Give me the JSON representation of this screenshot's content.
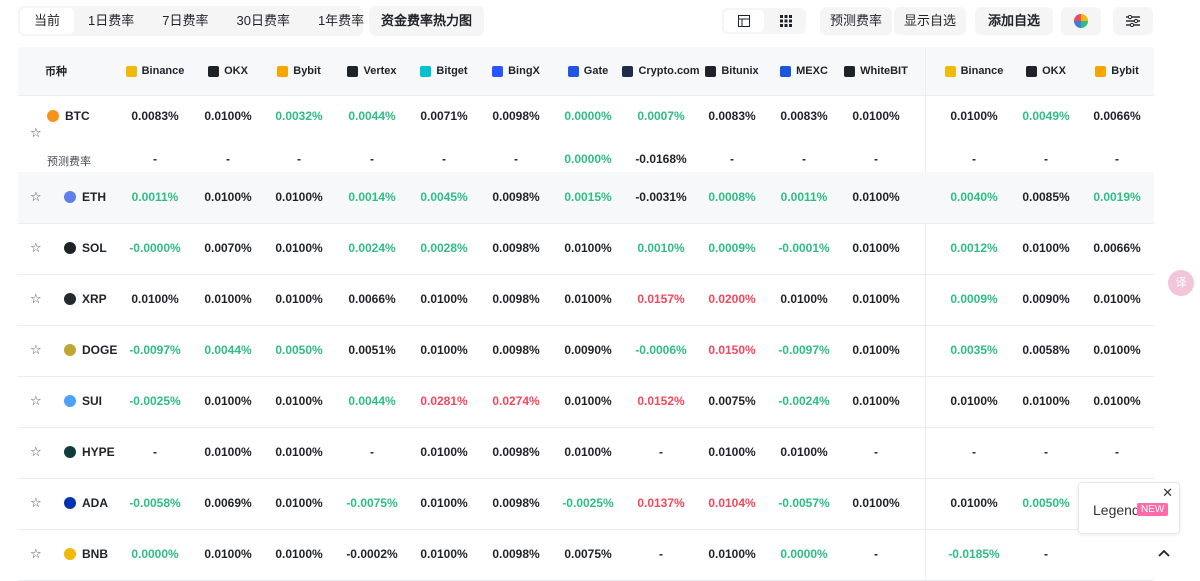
{
  "toolbar": {
    "tabs": [
      "当前",
      "1日费率",
      "7日费率",
      "30日费率",
      "1年费率"
    ],
    "heatmap_label": "资金费率热力图",
    "predict_label": "预测费率",
    "show_fav_label": "显示自选",
    "add_fav_label": "添加自选"
  },
  "table": {
    "coin_header": "币种",
    "exchanges": [
      "Binance",
      "OKX",
      "Bybit",
      "Vertex",
      "Bitget",
      "BingX",
      "Gate",
      "Crypto.com",
      "Bitunix",
      "MEXC",
      "WhiteBIT",
      "Binance",
      "OKX",
      "Bybit"
    ],
    "exchange_colors": [
      "#f0b90b",
      "#1e2329",
      "#f7a600",
      "#1e2329",
      "#00c2d1",
      "#2a54ff",
      "#2354e6",
      "#1f2b4d",
      "#1e2329",
      "#1a56db",
      "#1e2329",
      "#f0b90b",
      "#1e2329",
      "#f7a600"
    ],
    "prediction_label": "预测费率",
    "rows": [
      {
        "coin": "BTC",
        "icon_color": "#f7931a",
        "values": [
          "0.0083%",
          "0.0100%",
          "0.0032%",
          "0.0044%",
          "0.0071%",
          "0.0098%",
          "0.0000%",
          "0.0007%",
          "0.0083%",
          "0.0083%",
          "0.0100%",
          "0.0100%",
          "0.0049%",
          "0.0066%"
        ],
        "colors": [
          "k",
          "k",
          "g",
          "g",
          "k",
          "k",
          "g",
          "g",
          "k",
          "k",
          "k",
          "k",
          "g",
          "k"
        ],
        "pred": [
          "-",
          "-",
          "-",
          "-",
          "-",
          "-",
          "0.0000%",
          "-0.0168%",
          "-",
          "-",
          "-",
          "-",
          "-",
          "-"
        ],
        "pred_colors": [
          "k",
          "k",
          "k",
          "k",
          "k",
          "k",
          "g",
          "k",
          "k",
          "k",
          "k",
          "k",
          "k",
          "k"
        ]
      },
      {
        "coin": "ETH",
        "icon_color": "#627eea",
        "values": [
          "0.0011%",
          "0.0100%",
          "0.0100%",
          "0.0014%",
          "0.0045%",
          "0.0098%",
          "0.0015%",
          "-0.0031%",
          "0.0008%",
          "0.0011%",
          "0.0100%",
          "0.0040%",
          "0.0085%",
          "0.0019%"
        ],
        "colors": [
          "g",
          "k",
          "k",
          "g",
          "g",
          "k",
          "g",
          "k",
          "g",
          "g",
          "k",
          "g",
          "k",
          "g"
        ]
      },
      {
        "coin": "SOL",
        "icon_color": "#1e2329",
        "values": [
          "-0.0000%",
          "0.0070%",
          "0.0100%",
          "0.0024%",
          "0.0028%",
          "0.0098%",
          "0.0100%",
          "0.0010%",
          "0.0009%",
          "-0.0001%",
          "0.0100%",
          "0.0012%",
          "0.0100%",
          "0.0066%"
        ],
        "colors": [
          "g",
          "k",
          "k",
          "g",
          "g",
          "k",
          "k",
          "g",
          "g",
          "g",
          "k",
          "g",
          "k",
          "k"
        ]
      },
      {
        "coin": "XRP",
        "icon_color": "#23292f",
        "values": [
          "0.0100%",
          "0.0100%",
          "0.0100%",
          "0.0066%",
          "0.0100%",
          "0.0098%",
          "0.0100%",
          "0.0157%",
          "0.0200%",
          "0.0100%",
          "0.0100%",
          "0.0009%",
          "0.0090%",
          "0.0100%"
        ],
        "colors": [
          "k",
          "k",
          "k",
          "k",
          "k",
          "k",
          "k",
          "r",
          "r",
          "k",
          "k",
          "g",
          "k",
          "k"
        ]
      },
      {
        "coin": "DOGE",
        "icon_color": "#c2a633",
        "values": [
          "-0.0097%",
          "0.0044%",
          "0.0050%",
          "0.0051%",
          "0.0100%",
          "0.0098%",
          "0.0090%",
          "-0.0006%",
          "0.0150%",
          "-0.0097%",
          "0.0100%",
          "0.0035%",
          "0.0058%",
          "0.0100%"
        ],
        "colors": [
          "g",
          "g",
          "g",
          "k",
          "k",
          "k",
          "k",
          "g",
          "r",
          "g",
          "k",
          "g",
          "k",
          "k"
        ]
      },
      {
        "coin": "SUI",
        "icon_color": "#4da2ff",
        "values": [
          "-0.0025%",
          "0.0100%",
          "0.0100%",
          "0.0044%",
          "0.0281%",
          "0.0274%",
          "0.0100%",
          "0.0152%",
          "0.0075%",
          "-0.0024%",
          "0.0100%",
          "0.0100%",
          "0.0100%",
          "0.0100%"
        ],
        "colors": [
          "g",
          "k",
          "k",
          "g",
          "r",
          "r",
          "k",
          "r",
          "k",
          "g",
          "k",
          "k",
          "k",
          "k"
        ]
      },
      {
        "coin": "HYPE",
        "icon_color": "#0f3d3e",
        "values": [
          "-",
          "0.0100%",
          "0.0100%",
          "-",
          "0.0100%",
          "0.0098%",
          "0.0100%",
          "-",
          "0.0100%",
          "0.0100%",
          "-",
          "-",
          "-",
          "-"
        ],
        "colors": [
          "k",
          "k",
          "k",
          "k",
          "k",
          "k",
          "k",
          "k",
          "k",
          "k",
          "k",
          "k",
          "k",
          "k"
        ]
      },
      {
        "coin": "ADA",
        "icon_color": "#0033ad",
        "values": [
          "-0.0058%",
          "0.0069%",
          "0.0100%",
          "-0.0075%",
          "0.0100%",
          "0.0098%",
          "-0.0025%",
          "0.0137%",
          "0.0104%",
          "-0.0057%",
          "0.0100%",
          "0.0100%",
          "0.0050%",
          ""
        ],
        "colors": [
          "g",
          "k",
          "k",
          "g",
          "k",
          "k",
          "g",
          "r",
          "r",
          "g",
          "k",
          "k",
          "g",
          "k"
        ]
      },
      {
        "coin": "BNB",
        "icon_color": "#f0b90b",
        "values": [
          "0.0000%",
          "0.0100%",
          "0.0100%",
          "-0.0002%",
          "0.0100%",
          "0.0098%",
          "0.0075%",
          "-",
          "0.0100%",
          "0.0000%",
          "-",
          "-0.0185%",
          "-",
          ""
        ],
        "colors": [
          "g",
          "k",
          "k",
          "k",
          "k",
          "k",
          "k",
          "k",
          "k",
          "g",
          "k",
          "g",
          "k",
          "k"
        ]
      }
    ]
  },
  "legend": {
    "text": "Legend",
    "badge": "NEW"
  },
  "translate_label": "译"
}
